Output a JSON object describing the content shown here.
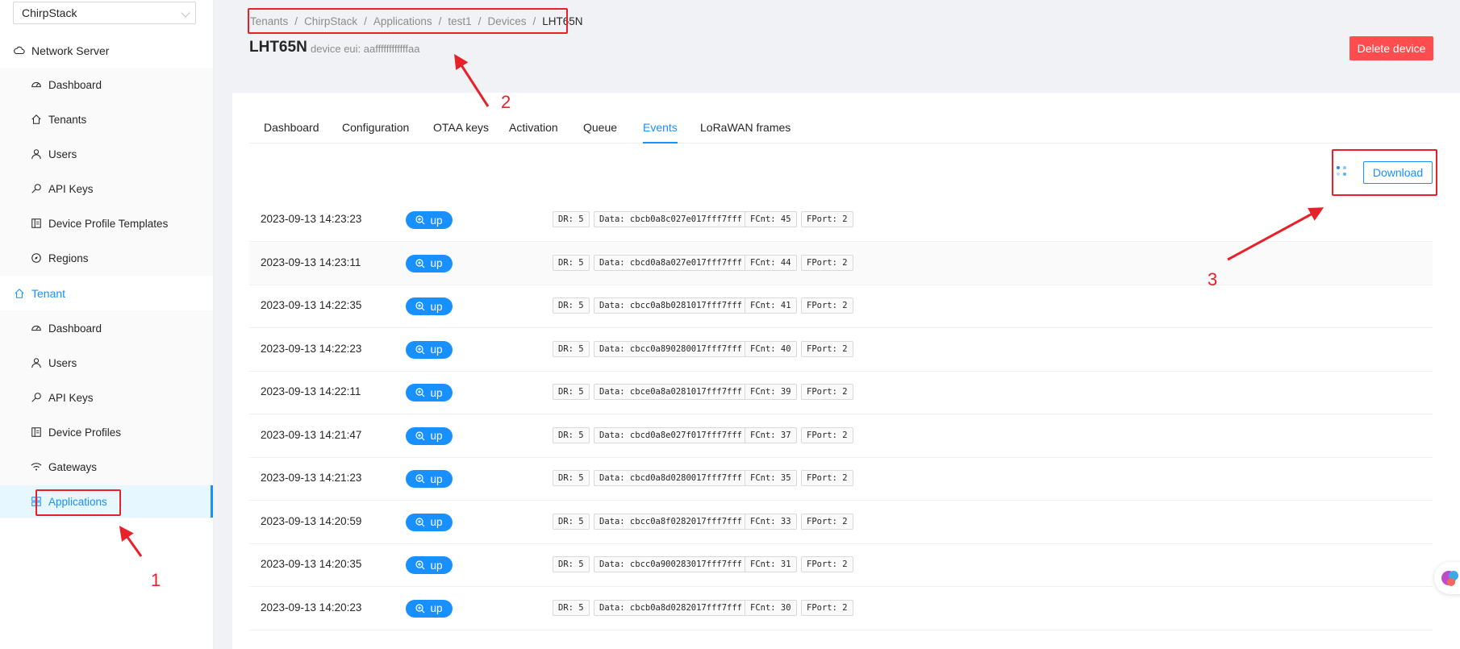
{
  "sidebar": {
    "tenant_select": "ChirpStack",
    "network_server": {
      "label": "Network Server",
      "items": [
        {
          "label": "Dashboard",
          "icon": "dashboard-icon"
        },
        {
          "label": "Tenants",
          "icon": "home-icon"
        },
        {
          "label": "Users",
          "icon": "user-icon"
        },
        {
          "label": "API Keys",
          "icon": "key-icon"
        },
        {
          "label": "Device Profile Templates",
          "icon": "template-icon"
        },
        {
          "label": "Regions",
          "icon": "compass-icon"
        }
      ]
    },
    "tenant": {
      "label": "Tenant",
      "items": [
        {
          "label": "Dashboard",
          "icon": "dashboard-icon"
        },
        {
          "label": "Users",
          "icon": "user-icon"
        },
        {
          "label": "API Keys",
          "icon": "key-icon"
        },
        {
          "label": "Device Profiles",
          "icon": "profile-icon"
        },
        {
          "label": "Gateways",
          "icon": "wifi-icon"
        },
        {
          "label": "Applications",
          "icon": "appstore-icon"
        }
      ]
    }
  },
  "breadcrumb": [
    "Tenants",
    "ChirpStack",
    "Applications",
    "test1",
    "Devices",
    "LHT65N"
  ],
  "header": {
    "title": "LHT65N",
    "subtitle": "device eui: aaffffffffffffaa",
    "delete_label": "Delete device"
  },
  "tabs": [
    {
      "label": "Dashboard"
    },
    {
      "label": "Configuration"
    },
    {
      "label": "OTAA keys"
    },
    {
      "label": "Activation"
    },
    {
      "label": "Queue"
    },
    {
      "label": "Events",
      "active": true
    },
    {
      "label": "LoRaWAN frames"
    }
  ],
  "download_label": "Download",
  "events": [
    {
      "time": "2023-09-13 14:23:23",
      "type": "up",
      "dr": "DR: 5",
      "data": "Data: cbcb0a8c027e017fff7fff",
      "fcnt": "FCnt: 45",
      "fport": "FPort: 2"
    },
    {
      "time": "2023-09-13 14:23:11",
      "type": "up",
      "dr": "DR: 5",
      "data": "Data: cbcd0a8a027e017fff7fff",
      "fcnt": "FCnt: 44",
      "fport": "FPort: 2"
    },
    {
      "time": "2023-09-13 14:22:35",
      "type": "up",
      "dr": "DR: 5",
      "data": "Data: cbcc0a8b0281017fff7fff",
      "fcnt": "FCnt: 41",
      "fport": "FPort: 2"
    },
    {
      "time": "2023-09-13 14:22:23",
      "type": "up",
      "dr": "DR: 5",
      "data": "Data: cbcc0a890280017fff7fff",
      "fcnt": "FCnt: 40",
      "fport": "FPort: 2"
    },
    {
      "time": "2023-09-13 14:22:11",
      "type": "up",
      "dr": "DR: 5",
      "data": "Data: cbce0a8a0281017fff7fff",
      "fcnt": "FCnt: 39",
      "fport": "FPort: 2"
    },
    {
      "time": "2023-09-13 14:21:47",
      "type": "up",
      "dr": "DR: 5",
      "data": "Data: cbcd0a8e027f017fff7fff",
      "fcnt": "FCnt: 37",
      "fport": "FPort: 2"
    },
    {
      "time": "2023-09-13 14:21:23",
      "type": "up",
      "dr": "DR: 5",
      "data": "Data: cbcd0a8d0280017fff7fff",
      "fcnt": "FCnt: 35",
      "fport": "FPort: 2"
    },
    {
      "time": "2023-09-13 14:20:59",
      "type": "up",
      "dr": "DR: 5",
      "data": "Data: cbcc0a8f0282017fff7fff",
      "fcnt": "FCnt: 33",
      "fport": "FPort: 2"
    },
    {
      "time": "2023-09-13 14:20:35",
      "type": "up",
      "dr": "DR: 5",
      "data": "Data: cbcc0a900283017fff7fff",
      "fcnt": "FCnt: 31",
      "fport": "FPort: 2"
    },
    {
      "time": "2023-09-13 14:20:23",
      "type": "up",
      "dr": "DR: 5",
      "data": "Data: cbcb0a8d0282017fff7fff",
      "fcnt": "FCnt: 30",
      "fport": "FPort: 2"
    }
  ],
  "annotations": {
    "one": "1",
    "two": "2",
    "three": "3"
  },
  "colors": {
    "accent": "#1890ff",
    "danger": "#ff4d4f",
    "annotation": "#e8202a"
  }
}
